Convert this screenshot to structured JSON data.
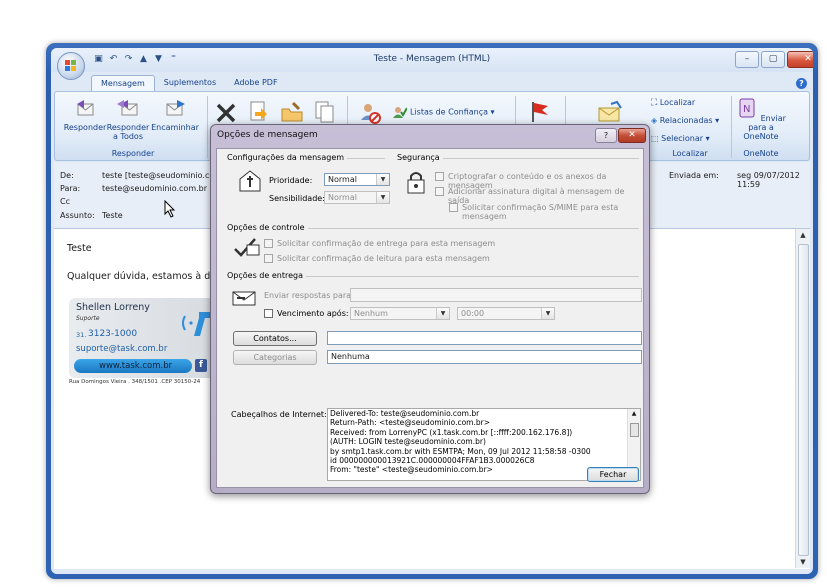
{
  "window": {
    "title": "Teste - Mensagem (HTML)",
    "controls": [
      "–",
      "▢",
      "✕"
    ]
  },
  "tabs": [
    {
      "label": "Mensagem",
      "active": true
    },
    {
      "label": "Suplementos",
      "active": false
    },
    {
      "label": "Adobe PDF",
      "active": false
    }
  ],
  "ribbon": {
    "respond": {
      "reply": "Responder",
      "reply_all": "Responder a Todos",
      "forward": "Encaminhar",
      "group": "Responder"
    },
    "safe_lists": "Listas de Confiança",
    "find": {
      "find": "Localizar",
      "related": "Relacionadas",
      "select": "Selecionar",
      "group": "Localizar"
    },
    "onenote": {
      "send": "Enviar para a OneNote",
      "group": "OneNote"
    }
  },
  "header": {
    "from_label": "De:",
    "from": "teste [teste@seudominio.com.",
    "to_label": "Para:",
    "to": "teste@seudominio.com.br",
    "cc_label": "Cc",
    "subject_label": "Assunto:",
    "subject": "Teste",
    "sent_label": "Enviada em:",
    "sent": "seg 09/07/2012 11:59"
  },
  "body": {
    "line1": "Teste",
    "line2": "Qualquer dúvida, estamos à dis",
    "signature": {
      "name": "Shellen Lorreny",
      "role": "Suporte",
      "phone_prefix": "31.",
      "phone": "3123-1000",
      "email": "suporte@task.com.br",
      "site": "www.task.com.br",
      "address": "Rua Domingos Vieira . 348/1501 .CEP 30150-24"
    }
  },
  "dialog": {
    "title": "Opções de mensagem",
    "help": "?",
    "close": "✕",
    "message_settings": {
      "title": "Configurações da mensagem",
      "priority_label": "Prioridade:",
      "priority": "Normal",
      "sensitivity_label": "Sensibilidade:",
      "sensitivity": "Normal"
    },
    "security": {
      "title": "Segurança",
      "encrypt": "Criptografar o conteúdo e os anexos da mensagem",
      "sign": "Adicionar assinatura digital à mensagem de saída",
      "smime": "Solicitar confirmação S/MIME para esta mensagem"
    },
    "tracking": {
      "title": "Opções de controle",
      "delivery": "Solicitar confirmação de entrega para esta mensagem",
      "read": "Solicitar confirmação de leitura para esta mensagem"
    },
    "delivery": {
      "title": "Opções de entrega",
      "replies_label": "Enviar respostas para:",
      "expires_label": "Vencimento após:",
      "expires_date": "Nenhum",
      "expires_time": "00:00"
    },
    "contacts_button": "Contatos...",
    "categories_button": "Categorias",
    "categories_value": "Nenhuma",
    "internet_headers_label": "Cabeçalhos de Internet:",
    "internet_headers": [
      "Delivered-To: teste@seudominio.com.br",
      "Return-Path: <teste@seudominio.com.br>",
      "Received: from LorrenyPC (x1.task.com.br [::ffff:200.162.176.8])",
      "  (AUTH: LOGIN teste@seudominio.com.br)",
      "  by smtp1.task.com.br with ESMTPA; Mon, 09 Jul 2012 11:58:58 -0300",
      "  id 000000000013921C.000000004FFAF1B3.000026C8",
      "From: \"teste\" <teste@seudominio.com.br>"
    ],
    "close_button": "Fechar"
  }
}
